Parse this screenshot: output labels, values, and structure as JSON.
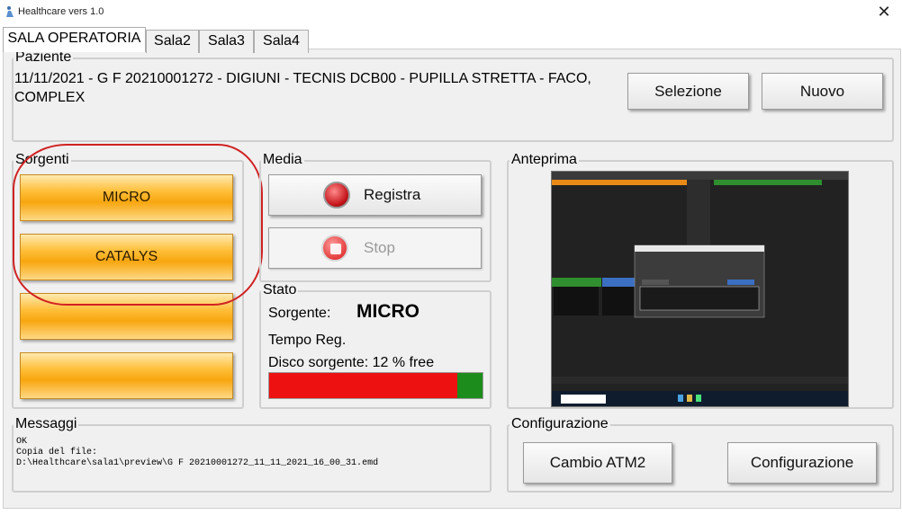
{
  "window": {
    "title": "Healthcare vers 1.0",
    "close_glyph": "✕"
  },
  "tabs": [
    {
      "label": "SALA OPERATORIA"
    },
    {
      "label": "Sala2"
    },
    {
      "label": "Sala3"
    },
    {
      "label": "Sala4"
    }
  ],
  "paziente": {
    "label": "Paziente",
    "text": "11/11/2021 - G F 20210001272 - DIGIUNI - TECNIS DCB00 - PUPILLA STRETTA  - FACO, COMPLEX",
    "selezione": "Selezione",
    "nuovo": "Nuovo"
  },
  "sorgenti": {
    "label": "Sorgenti",
    "buttons": [
      "MICRO",
      "CATALYS",
      "",
      ""
    ]
  },
  "media": {
    "label": "Media",
    "registra": "Registra",
    "stop": "Stop"
  },
  "stato": {
    "label": "Stato",
    "sorgente_label": "Sorgente:",
    "sorgente_value": "MICRO",
    "tempo_label": "Tempo Reg.",
    "disco_label": "Disco sorgente:  12 % free",
    "disk_free_fraction": 0.12
  },
  "anteprima": {
    "label": "Anteprima"
  },
  "messaggi": {
    "label": "Messaggi",
    "lines": [
      "OK",
      "Copia del file:",
      "D:\\Healthcare\\sala1\\preview\\G F 20210001272_11_11_2021_16_00_31.emd"
    ]
  },
  "configurazione": {
    "label": "Configurazione",
    "cambio": "Cambio ATM2",
    "config": "Configurazione"
  },
  "colors": {
    "accent_orange": "#f7a60f",
    "disk_used": "#e11111",
    "disk_free": "#1c8d1c",
    "annotation": "#d02222"
  },
  "icons": [
    "app-icon",
    "close-icon",
    "record-icon",
    "stop-icon"
  ]
}
